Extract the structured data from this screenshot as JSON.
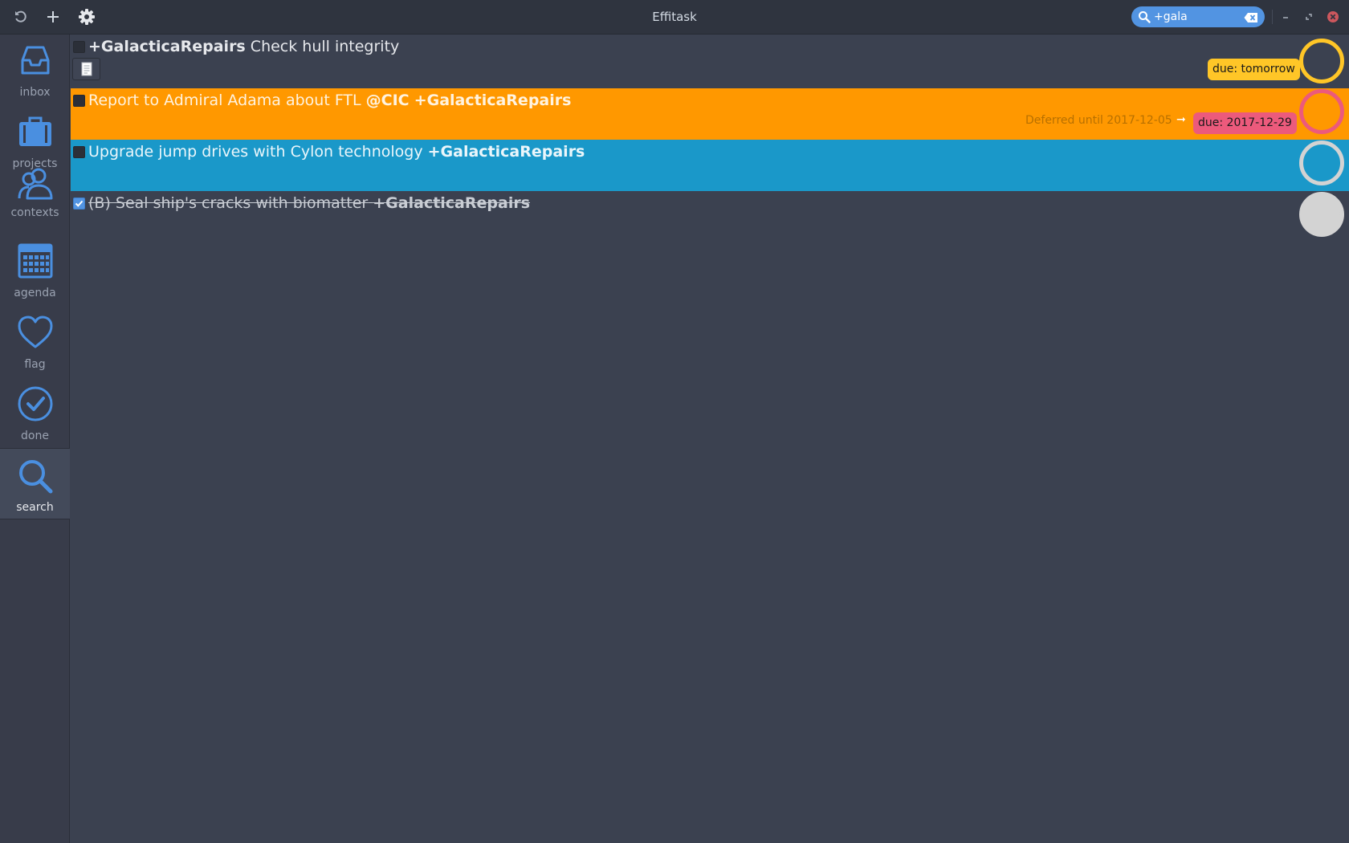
{
  "window": {
    "title": "Effitask"
  },
  "search": {
    "value": "+gala"
  },
  "sidebar": {
    "items": [
      {
        "label": "inbox"
      },
      {
        "label": "projects"
      },
      {
        "label": "contexts"
      },
      {
        "label": "agenda"
      },
      {
        "label": "flag"
      },
      {
        "label": "done"
      },
      {
        "label": "search"
      }
    ]
  },
  "tasks": [
    {
      "project": "+GalacticaRepairs",
      "text": "Check hull integrity",
      "due": "due: tomorrow",
      "done": false
    },
    {
      "text": "Report to Admiral Adama about FTL",
      "context": "@CIC",
      "project": "+GalacticaRepairs",
      "deferred": "Deferred until 2017-12-05",
      "arrow": "➞",
      "due": "due: 2017-12-29",
      "done": false
    },
    {
      "text": "Upgrade jump drives with Cylon technology",
      "project": "+GalacticaRepairs",
      "done": false
    },
    {
      "text": "(B) Seal ship's cracks with biomatter",
      "project": "+GalacticaRepairs",
      "done": true
    }
  ],
  "colors": {
    "accent": "#5294e2",
    "row_orange": "#ff9800",
    "row_blue": "#1a98c9",
    "due_yellow": "#ffc627",
    "due_pink": "#ec5a7c",
    "ring_grey": "#d3d3d3"
  },
  "icons": [
    "undo-icon",
    "add-icon",
    "gear-icon",
    "search-icon",
    "clear-icon",
    "minimize-icon",
    "maximize-icon",
    "close-icon",
    "note-icon"
  ]
}
